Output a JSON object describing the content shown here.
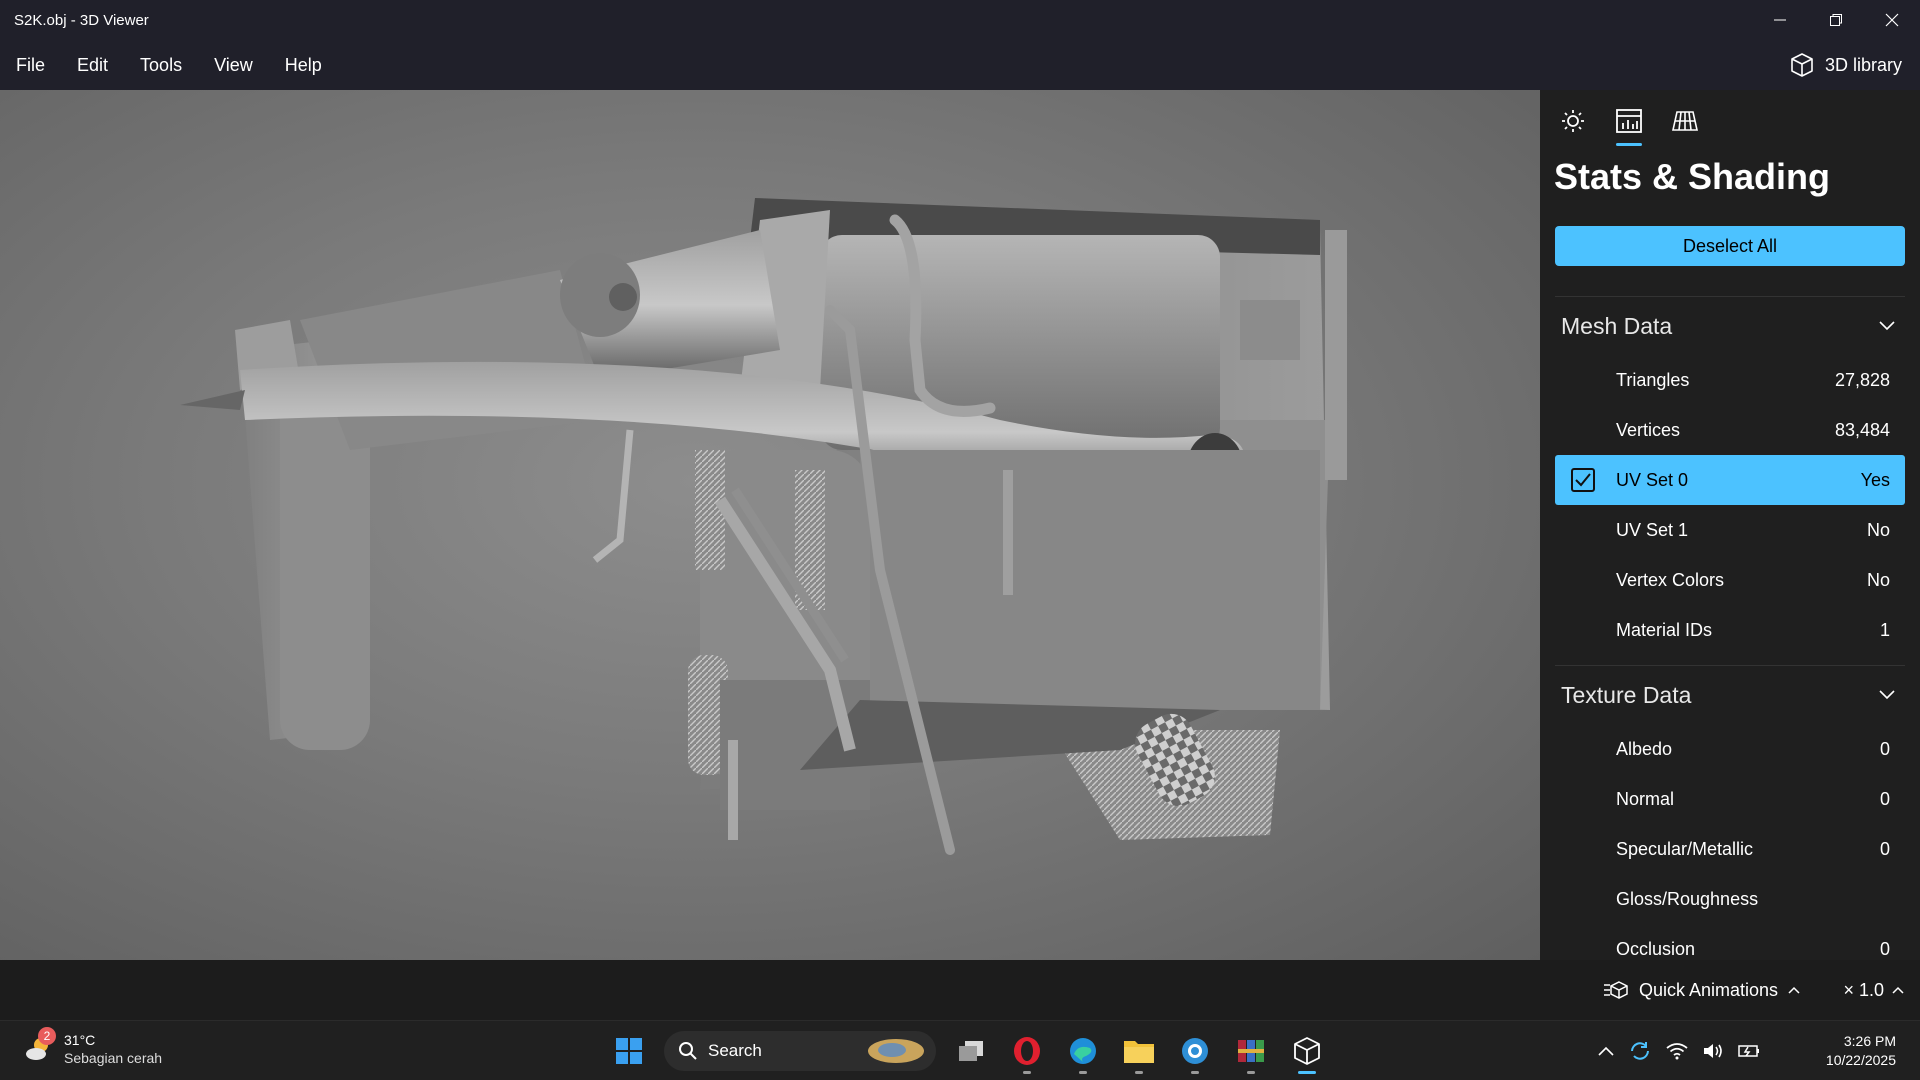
{
  "window": {
    "title": "S2K.obj - 3D Viewer"
  },
  "menu": {
    "items": [
      "File",
      "Edit",
      "Tools",
      "View",
      "Help"
    ],
    "library_label": "3D library"
  },
  "panel": {
    "title": "Stats & Shading",
    "deselect_label": "Deselect All",
    "mesh_section": "Mesh Data",
    "mesh_rows": [
      {
        "label": "Triangles",
        "value": "27,828"
      },
      {
        "label": "Vertices",
        "value": "83,484"
      },
      {
        "label": "UV Set 0",
        "value": "Yes"
      },
      {
        "label": "UV Set 1",
        "value": "No"
      },
      {
        "label": "Vertex Colors",
        "value": "No"
      },
      {
        "label": "Material IDs",
        "value": "1"
      }
    ],
    "texture_section": "Texture Data",
    "texture_rows": [
      {
        "label": "Albedo",
        "value": "0"
      },
      {
        "label": "Normal",
        "value": "0"
      },
      {
        "label": "Specular/Metallic",
        "value": "0"
      },
      {
        "label": "Gloss/Roughness",
        "value": ""
      },
      {
        "label": "Occlusion",
        "value": "0"
      }
    ]
  },
  "bottom": {
    "quick_animations": "Quick Animations",
    "speed": "× 1.0"
  },
  "taskbar": {
    "weather_temp": "31°C",
    "weather_cond": "Sebagian cerah",
    "weather_badge": "2",
    "search_label": "Search",
    "time": "3:26 PM",
    "date": "10/22/2025"
  },
  "colors": {
    "accent": "#4cc2ff",
    "chrome": "#20202a",
    "panel": "#1f1f1f"
  }
}
